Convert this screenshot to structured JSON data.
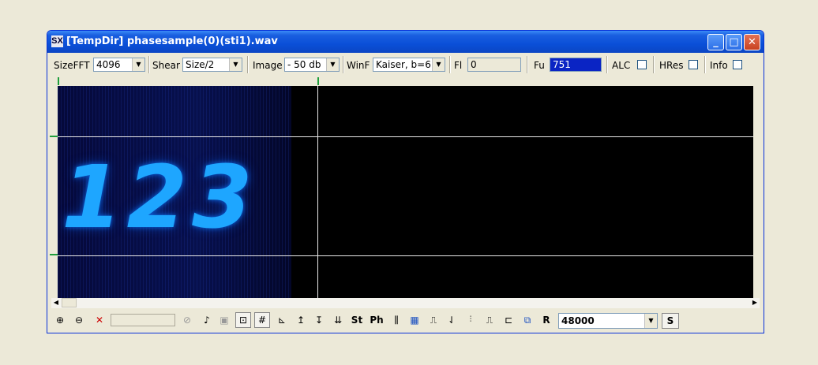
{
  "window": {
    "title": "[TempDir] phasesample(0)(sti1).wav",
    "title_icon": "SX"
  },
  "toolbar": {
    "sizefft_label": "SizeFFT",
    "sizefft_value": "4096",
    "shear_label": "Shear",
    "shear_value": "Size/2",
    "image_label": "Image",
    "image_value": "- 50 db",
    "winf_label": "WinF",
    "winf_value": "Kaiser, b=6",
    "fl_label": "Fl",
    "fl_value": "0",
    "fu_label": "Fu",
    "fu_value": "751",
    "alc_label": "ALC",
    "hres_label": "HRes",
    "info_label": "Info"
  },
  "spectrogram": {
    "digits": "123",
    "color": "#1ea6ff"
  },
  "bottom": {
    "icons": [
      "zoom-in-icon",
      "zoom-out-icon",
      "delete-icon",
      "disabled-icon",
      "speaker-icon",
      "stop-icon",
      "graph-icon",
      "grid-icon",
      "axis-icon",
      "arrow-up-icon",
      "arrow-down-icon",
      "multi-arrow-icon",
      "st-icon",
      "ph-icon",
      "bars-icon",
      "table-icon",
      "pulse-icon",
      "wave-icon",
      "lr-icon",
      "step-icon",
      "step2-icon",
      "copy-icon"
    ],
    "st_label": "St",
    "ph_label": "Ph",
    "r_label": "R",
    "samplerate_value": "48000",
    "s_label": "S"
  }
}
